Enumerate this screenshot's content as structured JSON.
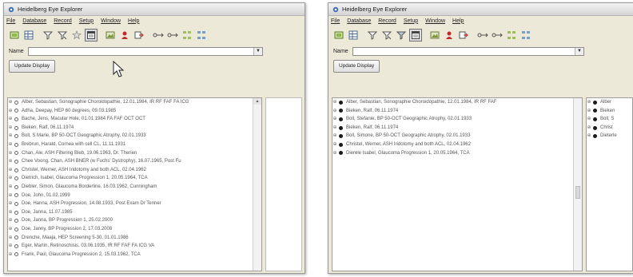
{
  "left": {
    "title": "Heidelberg Eye Explorer",
    "menu": [
      "File",
      "Database",
      "Record",
      "Setup",
      "Window",
      "Help"
    ],
    "name_label": "Name",
    "name_value": "",
    "update_button": "Update Display",
    "patients": [
      {
        "text": "Alber, Sebastian,  Sonographie Choroidopathie,  12.01.1984, IR RF FAF FA ICG"
      },
      {
        "text": "Adha, Deepay,  HEP 60 degrees, 09.03.1985"
      },
      {
        "text": "Bache, Jens,  Macular Hole,  01.01.1984 FA FAF OCT OCT"
      },
      {
        "text": "Bieken, Ralf,  06.11.1974"
      },
      {
        "text": "Boll, S Marie,  BP 50-OCT Geographic Atrophy,  02.01.1933"
      },
      {
        "text": "Brebrun, Harald,  Cornea with cell CL,  11.11.1931"
      },
      {
        "text": "Chan, Ale,  ASH Filtering Bleb,  19.06.1963, Dr. Therien"
      },
      {
        "text": "Chee Voong, Chan,  ASH BNER (w Fuchs' Dystrophy),  16.07.1965, Post Fu"
      },
      {
        "text": "Christel, Werner,  ASH Iridotomy and both ACL,  02.04.1962"
      },
      {
        "text": "Dietrich, Isabel,  Glaucoma Progression 1,  20.05.1964, TCA"
      },
      {
        "text": "Diebler, Simon,  Glaucoma Borderline,  16.03.1962, Cunningham"
      },
      {
        "text": "Doe, John,  01.02.1999"
      },
      {
        "text": "Doe, Hanna,  ASH Progression,  14.08.1933, Post Exam Dr Tenner"
      },
      {
        "text": "Doe, Janna,  11.07.1985"
      },
      {
        "text": "Doe, Janna,  BP Progression 1,  25.02.2000"
      },
      {
        "text": "Doe, Janny,  BP Progression 2,  17.03.2008"
      },
      {
        "text": "Drenche, Maaja,  HEP Screening 5-30,  01.01.1986"
      },
      {
        "text": "Eger, Martin,  Retinoschisis,  03.06.1935, IR RF FAF FA ICG VA"
      },
      {
        "text": "Frank, Paul,  Glaucoma Progression 2,  15.03.1962, TCA"
      }
    ]
  },
  "right": {
    "title": "Heidelberg Eye Explorer",
    "menu": [
      "File",
      "Database",
      "Record",
      "Setup",
      "Window",
      "Help"
    ],
    "name_label": "Name",
    "name_value": "",
    "update_button": "Update Display",
    "patients": [
      {
        "text": "Alber, Sebastian,  Sonographie Choroidopathie,  12.01.1984, IR RF FAF"
      },
      {
        "text": "Bieken, Ralf,  06.11.1974"
      },
      {
        "text": "Boll, Stefanie,  BP 50-OCT Geographic Atrophy,  02.01.1933"
      },
      {
        "text": "Bieken, Ralf,  06.11.1974"
      },
      {
        "text": "Boll, Simone,  BP 50-OCT Geographic Atrophy,  02.01.1933"
      },
      {
        "text": "Christel, Werner,  ASH Iridotomy and both ACL,  02.04.1962"
      },
      {
        "text": "Dierele Isabel,  Glaucoma Progression 1,  20.05.1964, TCA"
      }
    ],
    "side_patients": [
      "Alber",
      "Bieken",
      "Boll, S",
      "Christ",
      "Dieterle"
    ]
  },
  "icons": [
    "database-icon",
    "grid-icon",
    "filter-icon",
    "filter-clear-icon",
    "filter-star-icon",
    "calendar-icon",
    "image-icon",
    "patients-icon",
    "export-icon",
    "link-icon",
    "unlink-icon",
    "tree-icon",
    "tree-collapse-icon"
  ]
}
